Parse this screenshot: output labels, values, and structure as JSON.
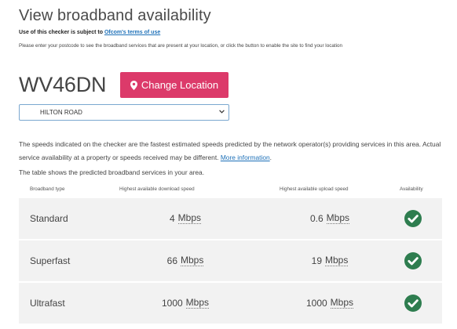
{
  "header": {
    "title": "View broadband availability",
    "terms_prefix": "Use of this checker is subject to",
    "terms_link": "Ofcom's terms of use",
    "intro": "Please enter your postcode to see the broadband services that are present at your location, or click the button to enable the site to find your location"
  },
  "location": {
    "postcode": "WV46DN",
    "change_button_label": "Change Location",
    "selected_address": "HILTON ROAD"
  },
  "info": {
    "paragraph": "The speeds indicated on the checker are the fastest estimated speeds predicted by the network operator(s) providing services in this area. Actual service availability at a property or speeds received may be different.",
    "more_link": "More information",
    "after_link": ".",
    "table_intro": "The table shows the predicted broadband services in your area."
  },
  "table": {
    "headers": {
      "type": "Broadband type",
      "download": "Highest available download speed",
      "upload": "Highest available upload speed",
      "availability": "Availability"
    },
    "rows": [
      {
        "type": "Standard",
        "download": "4",
        "download_unit": "Mbps",
        "upload": "0.6",
        "upload_unit": "Mbps",
        "available": true
      },
      {
        "type": "Superfast",
        "download": "66",
        "download_unit": "Mbps",
        "upload": "19",
        "upload_unit": "Mbps",
        "available": true
      },
      {
        "type": "Ultrafast",
        "download": "1000",
        "download_unit": "Mbps",
        "upload": "1000",
        "upload_unit": "Mbps",
        "available": true
      }
    ]
  },
  "icons": {
    "button_icon": "map-marker-icon",
    "select_icon": "chevron-down-icon",
    "availability_icon": "check-circle-icon"
  },
  "colors": {
    "button": "#dc3a6a",
    "link": "#1d70b8",
    "available": "#2e7d4f",
    "row_background": "#f2f2f2"
  }
}
